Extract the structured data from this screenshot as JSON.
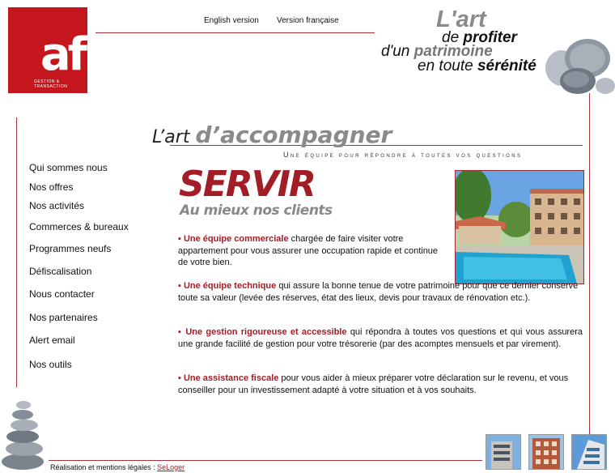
{
  "brand": {
    "logo_text": "af",
    "logo_tagline": "GESTION & TRANSACTION"
  },
  "lang": {
    "english": "English version",
    "french": "Version française"
  },
  "slogan": {
    "line1": "L'art",
    "line2_pre": "de ",
    "line2_b": "profiter",
    "line3_pre": "d'un ",
    "line3_b": "patrimoine",
    "line4_pre": "en toute ",
    "line4_b": "sérénité"
  },
  "heading": {
    "small": "L’art ",
    "large": "d’accompagner",
    "subtitle": "Une équipe pour répondre à toutes vos questions"
  },
  "nav": [
    "Qui sommes nous",
    "Nos offres",
    "Nos activités",
    "Commerces & bureaux",
    "Programmes neufs",
    "Défiscalisation",
    "Nous contacter",
    "Nos partenaires",
    "Alert email",
    "Nos outils"
  ],
  "servir": {
    "title": "SERVIR",
    "subtitle": "Au mieux nos clients"
  },
  "paragraphs": [
    {
      "bullet": "▪ ",
      "highlight": "Une équipe commerciale",
      "text": " chargée de faire visiter votre appartement pour vous assurer une occupation rapide et continue de votre bien."
    },
    {
      "bullet": "▪ ",
      "highlight": "Une équipe technique",
      "text": " qui assure la bonne tenue de votre patrimoine pour que ce dernier conserve toute sa valeur (levée des réserves, état des lieux, devis pour travaux de rénovation etc.)."
    },
    {
      "bullet": "▪ ",
      "highlight": "Une gestion rigoureuse et accessible",
      "text": " qui répondra à toutes vos questions et qui vous assurera une grande facilité de gestion pour votre trésorerie (par des acomptes mensuels et par virement)."
    },
    {
      "bullet": "▪ ",
      "highlight": "Une assistance fiscale",
      "text": " pour vous aider à mieux préparer votre déclaration sur le revenu, et vous conseiller pour un investissement adapté à votre situation et à vos souhaits."
    }
  ],
  "footer": {
    "label": "Réalisation et mentions légales : ",
    "link": "SeLoger"
  },
  "colors": {
    "brand_red": "#c4161c",
    "accent_red": "#a21d26",
    "rule": "#a8333b"
  },
  "icons": {
    "pebbles": "stacked-stones-image",
    "pool": "residence-pool-photo",
    "thumbs": [
      "building-thumb-1",
      "building-thumb-2",
      "building-thumb-3"
    ]
  }
}
